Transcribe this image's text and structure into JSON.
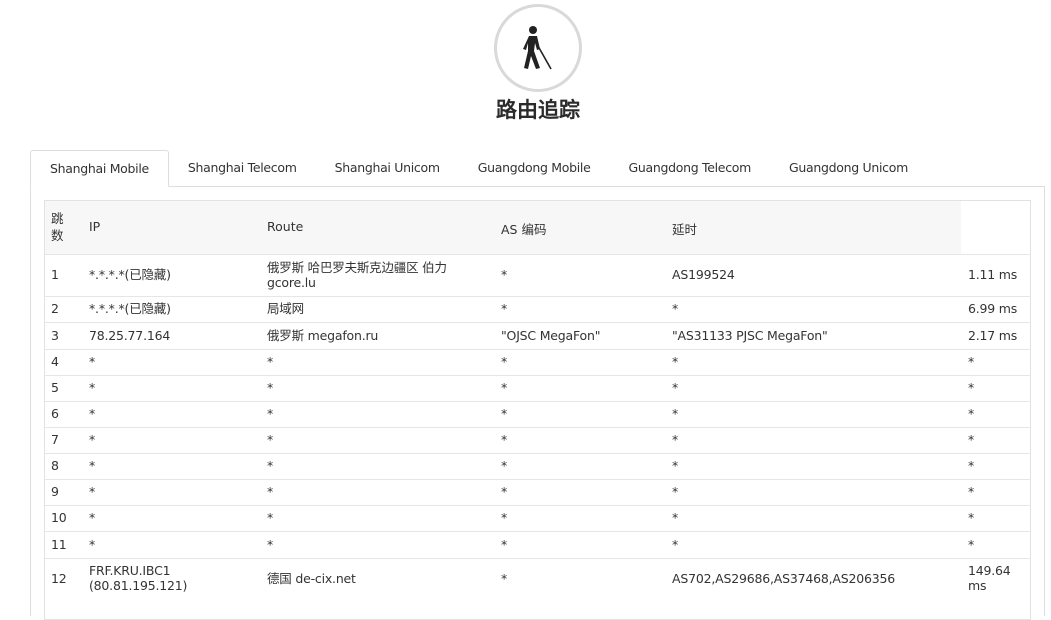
{
  "page": {
    "title": "路由追踪",
    "logo_icon": "blind-person-icon"
  },
  "tabs": [
    {
      "label": "Shanghai Mobile",
      "active": true
    },
    {
      "label": "Shanghai Telecom",
      "active": false
    },
    {
      "label": "Shanghai Unicom",
      "active": false
    },
    {
      "label": "Guangdong Mobile",
      "active": false
    },
    {
      "label": "Guangdong Telecom",
      "active": false
    },
    {
      "label": "Guangdong Unicom",
      "active": false
    }
  ],
  "table": {
    "headers": {
      "hop": "跳数",
      "ip": "IP",
      "route": "Route",
      "as": "AS 编码",
      "latency": "延时"
    },
    "rows": [
      {
        "hop": "1",
        "ip": "*.*.*.*(已隐藏)",
        "route": "俄罗斯 哈巴罗夫斯克边疆区 伯力",
        "route2": "gcore.lu",
        "as": "*",
        "asname": "AS199524",
        "latency": "1.11 ms"
      },
      {
        "hop": "2",
        "ip": "*.*.*.*(已隐藏)",
        "route": "局域网",
        "route2": "",
        "as": "*",
        "asname": "*",
        "latency": "6.99 ms"
      },
      {
        "hop": "3",
        "ip": "78.25.77.164",
        "route": "俄罗斯 megafon.ru",
        "route2": "",
        "as": "\"OJSC MegaFon\"",
        "asname": "\"AS31133 PJSC MegaFon\"",
        "latency": "2.17 ms"
      },
      {
        "hop": "4",
        "ip": "*",
        "route": "*",
        "route2": "",
        "as": "*",
        "asname": "*",
        "latency": "*"
      },
      {
        "hop": "5",
        "ip": "*",
        "route": "*",
        "route2": "",
        "as": "*",
        "asname": "*",
        "latency": "*"
      },
      {
        "hop": "6",
        "ip": "*",
        "route": "*",
        "route2": "",
        "as": "*",
        "asname": "*",
        "latency": "*"
      },
      {
        "hop": "7",
        "ip": "*",
        "route": "*",
        "route2": "",
        "as": "*",
        "asname": "*",
        "latency": "*"
      },
      {
        "hop": "8",
        "ip": "*",
        "route": "*",
        "route2": "",
        "as": "*",
        "asname": "*",
        "latency": "*"
      },
      {
        "hop": "9",
        "ip": "*",
        "route": "*",
        "route2": "",
        "as": "*",
        "asname": "*",
        "latency": "*"
      },
      {
        "hop": "10",
        "ip": "*",
        "route": "*",
        "route2": "",
        "as": "*",
        "asname": "*",
        "latency": "*"
      },
      {
        "hop": "11",
        "ip": "*",
        "route": "*",
        "route2": "",
        "as": "*",
        "asname": "*",
        "latency": "*"
      },
      {
        "hop": "12",
        "ip": "FRF.KRU.IBC1",
        "ip2": "(80.81.195.121)",
        "route": "德国 de-cix.net",
        "route2": "",
        "as": "*",
        "asname": "AS702,AS29686,AS37468,AS206356",
        "latency": "149.64",
        "latency2": "ms"
      }
    ]
  }
}
